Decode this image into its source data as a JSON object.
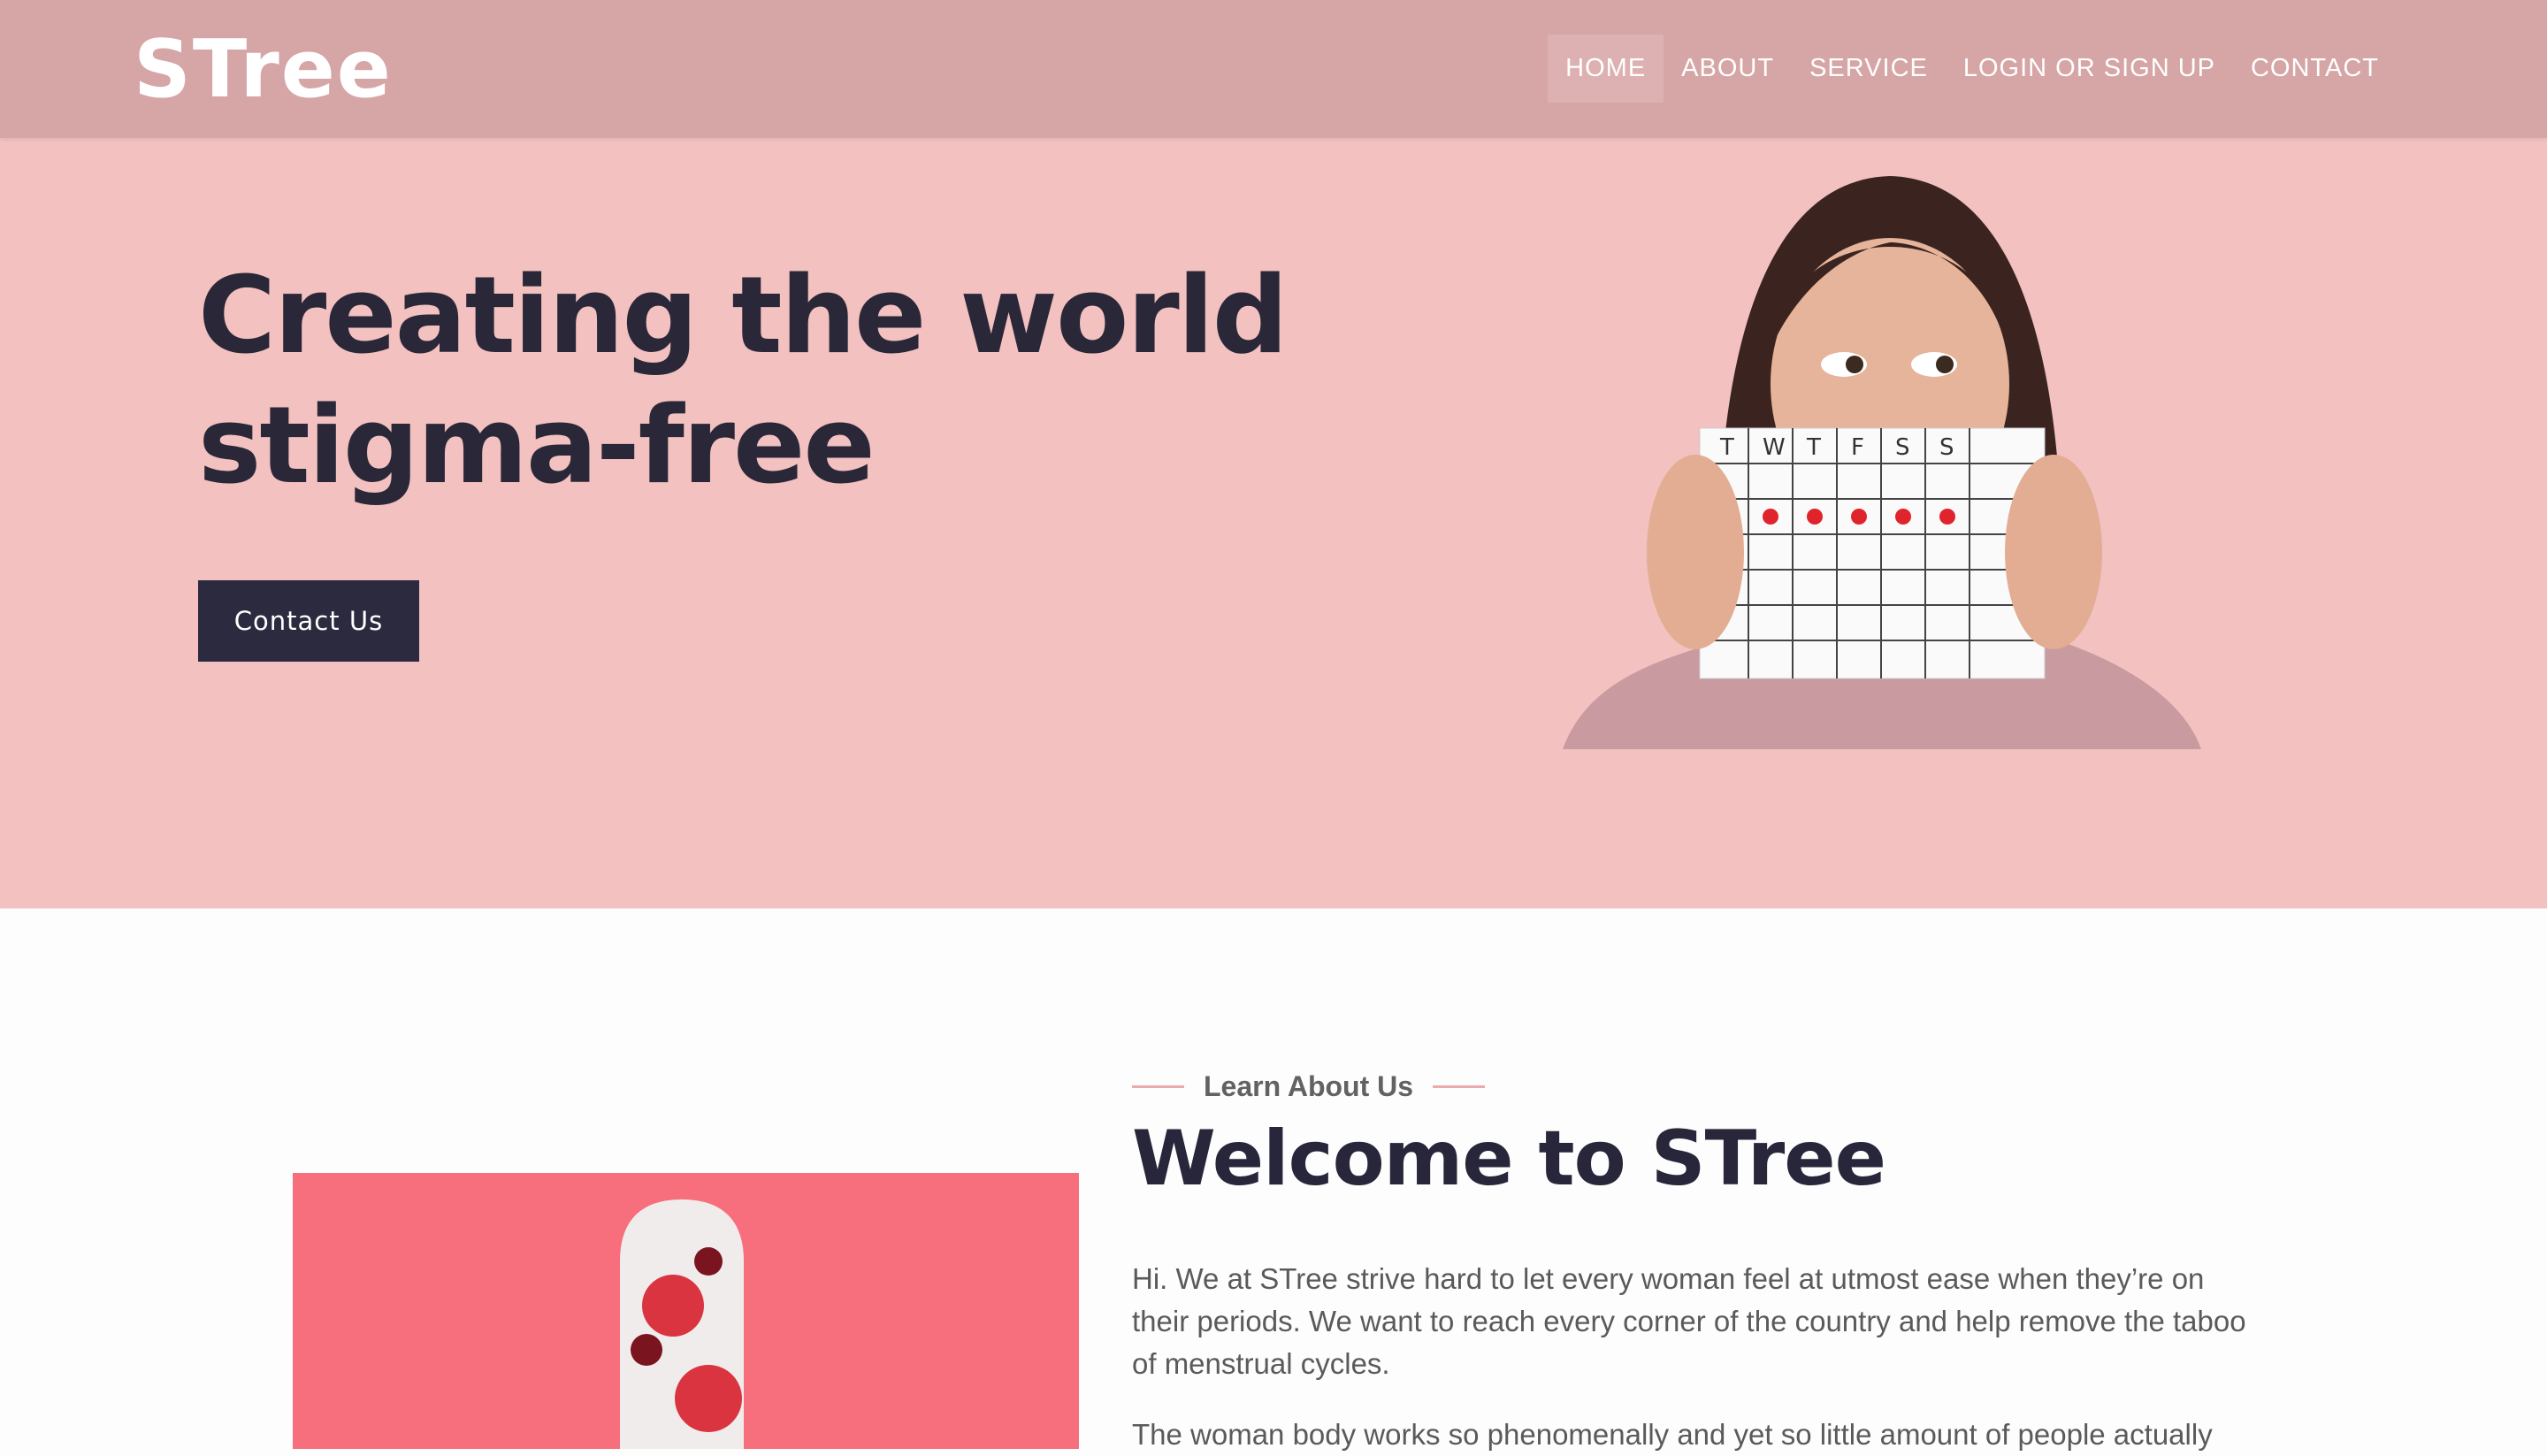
{
  "brand": {
    "logo": "STree"
  },
  "nav": {
    "items": [
      "HOME",
      "ABOUT",
      "SERVICE",
      "LOGIN OR SIGN UP",
      "CONTACT"
    ],
    "active": "HOME"
  },
  "hero": {
    "headline": "Creating the world stigma-free",
    "button": "Contact Us",
    "calendar_days": [
      "T",
      "W",
      "T",
      "F",
      "S",
      "S"
    ]
  },
  "about": {
    "eyebrow": "Learn About Us",
    "title": "Welcome to STree",
    "paragraphs": [
      "Hi. We at STree strive hard to let every woman feel at utmost ease when they’re on their periods. We want to reach every corner of the country and help remove the taboo of menstrual cycles.",
      "The woman body works so phenomenally and yet so little amount of people actually"
    ]
  },
  "colors": {
    "nav": "#d6a5a6",
    "hero": "#f2c1c0",
    "dark": "#2b2a3e",
    "accent": "#ecaaaa"
  }
}
